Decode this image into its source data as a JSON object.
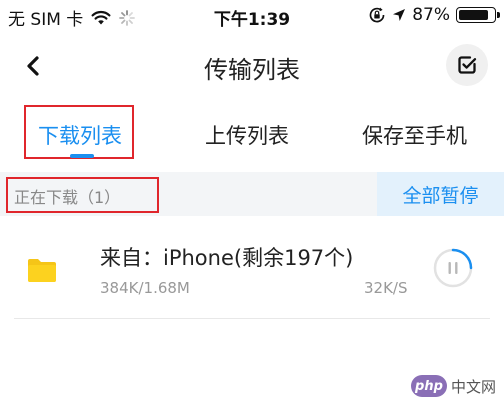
{
  "status_bar": {
    "carrier": "无 SIM 卡",
    "wifi_icon": "wifi-icon",
    "activity_icon": "loading-spinner-icon",
    "time": "下午1:39",
    "orientation_lock_icon": "orientation-lock-icon",
    "location_icon": "location-arrow-icon",
    "battery_percent": "87%",
    "battery_level": 0.87
  },
  "nav": {
    "back_icon": "chevron-left-icon",
    "title": "传输列表",
    "edit_icon": "checkbox-edit-icon"
  },
  "tabs": [
    {
      "label": "下载列表",
      "active": true
    },
    {
      "label": "上传列表",
      "active": false
    },
    {
      "label": "保存至手机",
      "active": false
    }
  ],
  "section": {
    "title": "正在下载（1）",
    "pause_all_label": "全部暂停"
  },
  "downloads": [
    {
      "icon": "folder-icon",
      "title": "来自：iPhone(剩余197个)",
      "size": "384K/1.68M",
      "speed": "32K/S",
      "progress": 0.25,
      "action_icon": "pause-icon"
    }
  ],
  "colors": {
    "accent": "#1a8ff0",
    "highlight_border": "#e0262c",
    "folder": "#f5c518",
    "section_bg": "#f3f5f7"
  },
  "watermark": {
    "logo": "php",
    "text": "中文网"
  }
}
